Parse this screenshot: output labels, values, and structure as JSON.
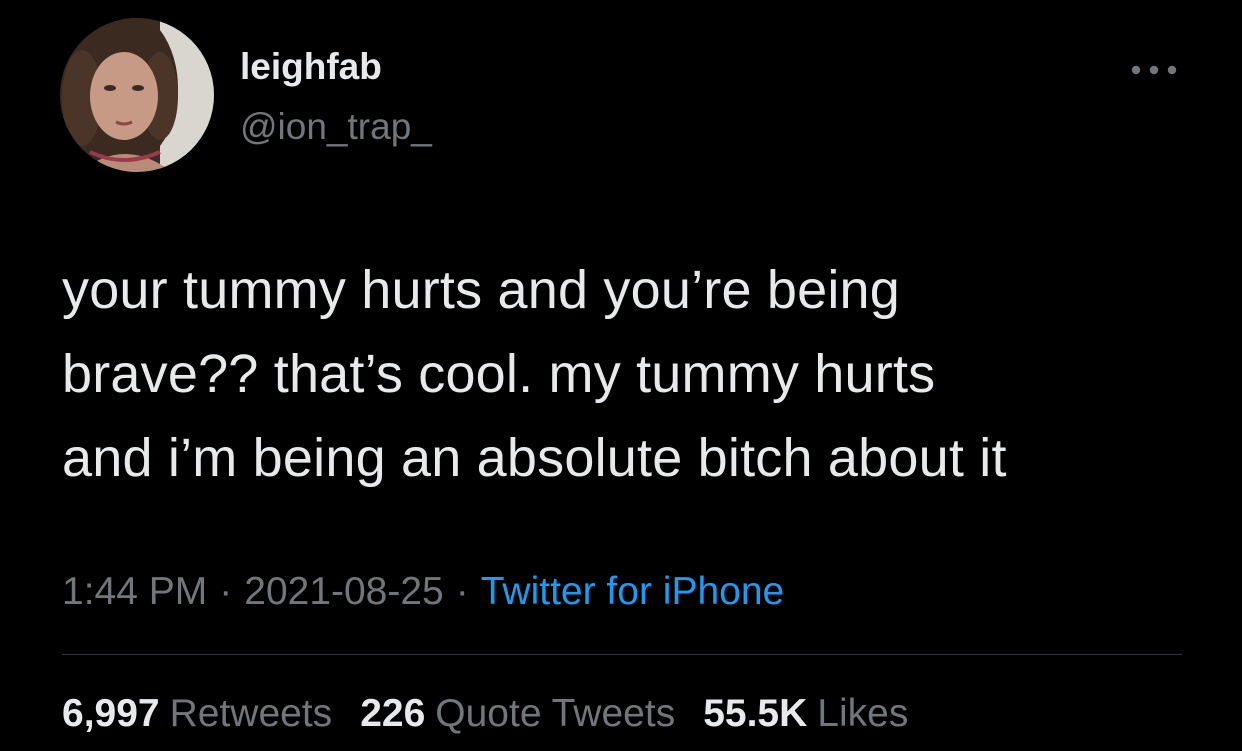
{
  "user": {
    "display_name": "leighfab",
    "handle": "@ion_trap_"
  },
  "tweet": {
    "lines": [
      "your tummy hurts and you’re being",
      "brave?? that’s cool. my tummy hurts",
      "and i’m being an absolute bitch about it"
    ],
    "time": "1:44 PM",
    "date": "2021-08-25",
    "separator": "·",
    "source": "Twitter for iPhone"
  },
  "stats": {
    "retweets_count": "6,997",
    "retweets_label": "Retweets",
    "quotes_count": "226",
    "quotes_label": "Quote Tweets",
    "likes_count": "55.5K",
    "likes_label": "Likes"
  },
  "icons": {
    "more": "more-horizontal-icon"
  },
  "colors": {
    "background": "#000000",
    "primary_text": "#e7e9ea",
    "secondary_text": "#71767b",
    "link": "#1d9bf0",
    "divider": "#2f3336"
  }
}
